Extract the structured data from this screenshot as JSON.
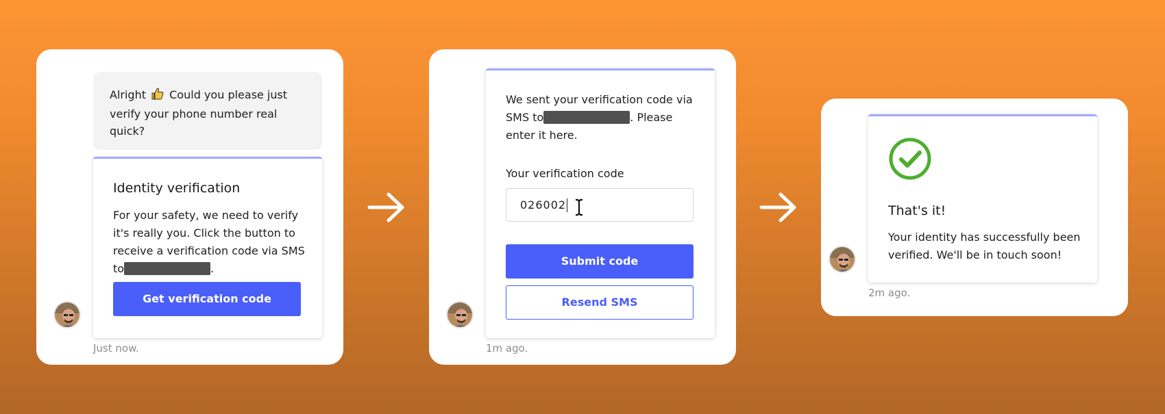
{
  "step1": {
    "bubble_line1_before": "Alright",
    "bubble_line1_after": "Could you please just",
    "bubble_line2": "verify your phone number real quick?",
    "card_title": "Identity verification",
    "card_text_1": "For your safety, we need to verify",
    "card_text_2": "it's really you. Click the button to",
    "card_text_3": "receive a verification code via SMS",
    "card_text_4_prefix": "to",
    "card_text_4_suffix": ".",
    "button_label": "Get verification code",
    "timestamp": "Just now."
  },
  "step2": {
    "text_1": "We sent your verification code via",
    "text_2_prefix": "SMS to",
    "text_2_suffix": ". Please",
    "text_3": "enter it here.",
    "field_label": "Your verification code",
    "code_value": "026002",
    "submit_label": "Submit code",
    "resend_label": "Resend SMS",
    "timestamp": "1m ago."
  },
  "step3": {
    "title": "That's it!",
    "text_1": "Your identity has successfully been",
    "text_2": "verified. We'll be in touch soon!",
    "timestamp": "2m ago."
  },
  "colors": {
    "background_top": "#fd9535",
    "background_bottom": "#b26726",
    "primary_button": "#4a5ef9",
    "card_accent": "#9eaafc",
    "success_green": "#4caf2c",
    "redaction": "#505050"
  },
  "icons": [
    "thumbs-up-icon",
    "arrow-right-icon",
    "check-circle-icon",
    "text-cursor-icon",
    "avatar"
  ]
}
